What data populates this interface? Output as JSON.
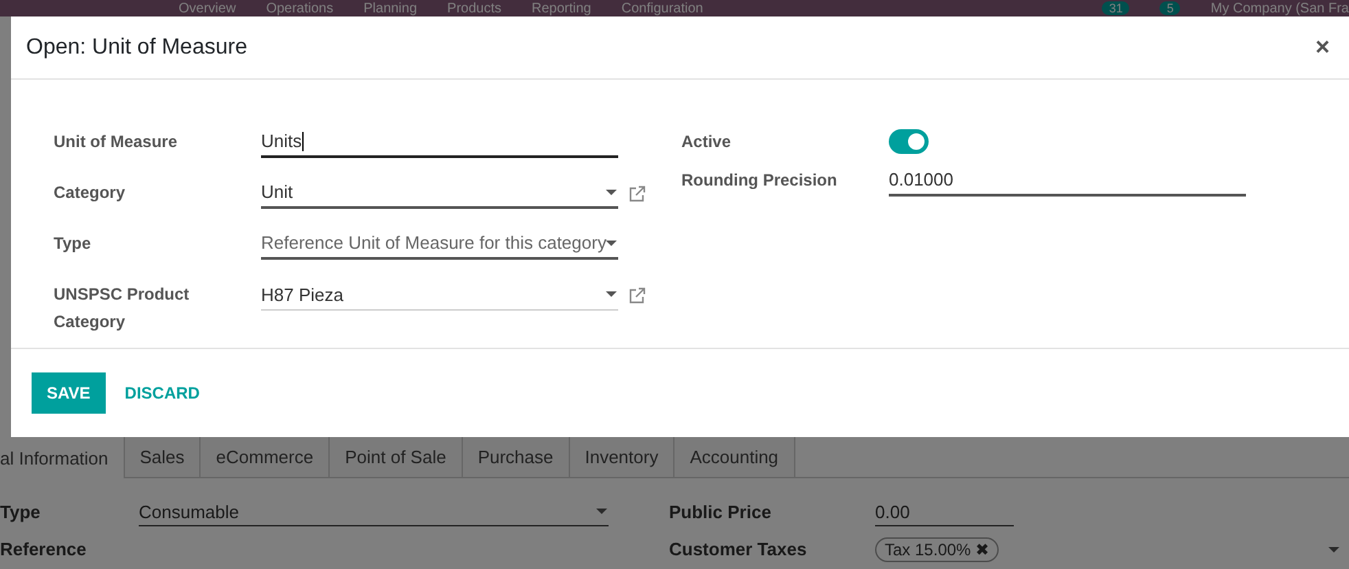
{
  "navbar": {
    "items": [
      "Overview",
      "Operations",
      "Planning",
      "Products",
      "Reporting",
      "Configuration"
    ],
    "badges": [
      "31",
      "5"
    ],
    "company": "My Company (San Fra"
  },
  "background": {
    "tabs": [
      {
        "label": "al Information",
        "selected": true
      },
      {
        "label": "Sales",
        "selected": false
      },
      {
        "label": "eCommerce",
        "selected": false
      },
      {
        "label": "Point of Sale",
        "selected": false
      },
      {
        "label": "Purchase",
        "selected": false
      },
      {
        "label": "Inventory",
        "selected": false
      },
      {
        "label": "Accounting",
        "selected": false
      }
    ],
    "left_fields": [
      {
        "label": "Type",
        "kind": "select",
        "value": "Consumable"
      },
      {
        "label": "Reference",
        "kind": "text"
      }
    ],
    "right_fields": [
      {
        "label": "Public Price",
        "kind": "text",
        "value": "0.00"
      },
      {
        "label": "Customer Taxes",
        "kind": "tags",
        "tags": [
          "Tax 15.00%"
        ],
        "remove": "✖"
      }
    ]
  },
  "dialog": {
    "title": "Open: Unit of Measure",
    "close": "×",
    "left_fields": [
      {
        "label": "Unit of Measure",
        "kind": "text",
        "value": "Units",
        "focused": true,
        "link": false
      },
      {
        "label": "Category",
        "kind": "select",
        "value": "Unit",
        "focused": false,
        "link": true
      },
      {
        "label": "Type",
        "kind": "select",
        "value": "Reference Unit of Measure for this category",
        "focused": false,
        "link": false
      },
      {
        "label": "UNSPSC Product Category",
        "kind": "select",
        "value": "H87 Pieza",
        "focused": false,
        "link": true
      }
    ],
    "right_fields": [
      {
        "label": "Active",
        "kind": "toggle",
        "on": true
      },
      {
        "label": "Rounding Precision",
        "kind": "text",
        "value": "0.01000"
      }
    ],
    "buttons": [
      {
        "label": "SAVE",
        "kind": "primary"
      },
      {
        "label": "DISCARD",
        "kind": "link"
      }
    ]
  }
}
